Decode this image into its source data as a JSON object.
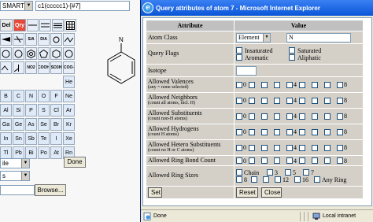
{
  "editor": {
    "smarts_label": "SMARTS",
    "smarts_value": "c1(ccccc1)-[#7]",
    "toolbar": {
      "row1": [
        "Del",
        "Qry",
        "",
        "",
        "",
        ""
      ],
      "row2": [
        "",
        "",
        "S/A",
        "D/A",
        "",
        "",
        ""
      ],
      "row3": [
        "",
        "",
        "",
        "",
        "",
        "",
        ""
      ],
      "row4": [
        "",
        "",
        "NO2",
        "COOH",
        "SO3H",
        "COO-"
      ],
      "row5": [
        "He"
      ],
      "elements": [
        [
          "B",
          "C",
          "N",
          "O",
          "F",
          "Ne"
        ],
        [
          "Al",
          "Si",
          "P",
          "S",
          "Cl",
          "Ar"
        ],
        [
          "Ga",
          "Ge",
          "As",
          "Se",
          "Br",
          "Kr"
        ],
        [
          "In",
          "Sn",
          "Sb",
          "Te",
          "I",
          "Xe"
        ],
        [
          "Tl",
          "Pb",
          "Bi",
          "Po",
          "At",
          "Rn"
        ]
      ]
    },
    "molecule_atom_label": "N",
    "mode_select": "ile",
    "done_label": "Done",
    "type_select": "s",
    "browse_label": "Browse..."
  },
  "popup": {
    "title": "Query attributes of atom 7 - Microsoft Internet Explorer",
    "headers": {
      "attribute": "Attribute",
      "value": "Value"
    },
    "atom_class": {
      "label": "Atom Class",
      "select": "Element",
      "value": "N"
    },
    "query_flags": {
      "label": "Query Flags",
      "options": [
        "Insaturated",
        "Saturated",
        "Aromatic",
        "Aliphatic"
      ]
    },
    "isotope": {
      "label": "Isotope",
      "value": ""
    },
    "valences": {
      "label": "Allowed Valences",
      "sub": "(any = none selected)",
      "options": [
        "0",
        "",
        "",
        "",
        "4",
        "",
        "",
        "",
        "8"
      ]
    },
    "neighbors": {
      "label": "Allowed Neighbors",
      "sub": "(count all atoms, incl. H)",
      "options": [
        "0",
        "",
        "",
        "",
        "4",
        "",
        "",
        "",
        "8"
      ]
    },
    "substituents": {
      "label": "Allowed Substituents",
      "sub": "(count non-H atoms)",
      "options": [
        "0",
        "",
        "",
        "",
        "4",
        "",
        "",
        "",
        "8"
      ]
    },
    "hydrogens": {
      "label": "Allowed Hydrogens",
      "sub": "(count H atoms)",
      "options": [
        "0",
        "",
        "",
        "",
        "4",
        "",
        "",
        "",
        "8"
      ]
    },
    "hetero": {
      "label": "Allowed Hetero Substituents",
      "sub": "(count no H or C atoms)",
      "options": [
        "0",
        "",
        "",
        "",
        "4",
        "",
        "",
        "",
        "8"
      ]
    },
    "ring_bond": {
      "label": "Allowed Ring Bond Count",
      "options": [
        "0",
        "",
        "",
        "",
        "4",
        "",
        "",
        "",
        "8"
      ]
    },
    "ring_sizes": {
      "label": "Allowed Ring Sizes",
      "line1": [
        "Chain",
        "3",
        "5",
        "7"
      ],
      "line2": [
        "8",
        "",
        "",
        "12",
        "16",
        "Any Ring"
      ]
    },
    "buttons": {
      "set": "Set",
      "reset": "Reset",
      "close": "Close"
    },
    "status": {
      "text": "Done",
      "zone": "Local intranet"
    }
  }
}
